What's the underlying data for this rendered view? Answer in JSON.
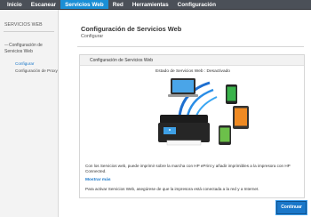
{
  "nav": {
    "tabs": [
      {
        "label": "Inicio"
      },
      {
        "label": "Escanear"
      },
      {
        "label": "Servicios Web",
        "active": true
      },
      {
        "label": "Red"
      },
      {
        "label": "Herramientas"
      },
      {
        "label": "Configuración"
      }
    ]
  },
  "sidebar": {
    "title": "SERVICIOS WEB",
    "group_label": "Configuración de Servicios Web",
    "items": [
      {
        "label": "Configurar",
        "active": true
      },
      {
        "label": "Configuración de Proxy"
      }
    ]
  },
  "main": {
    "title": "Configuración de Servicios Web",
    "subtitle": "Configurar",
    "panel_title": "Configuración de Servicios Web",
    "status": "Estado de Servicios Web : Desactivado",
    "description": "Con los Servicios web, puede imprimir sobre la marcha con HP ePrint y añadir imprimibles a la impresora con HP Connected.",
    "more_link": "Mostrar más",
    "instruction": "Para activar Servicios Web, asegúrese de que la impresora está conectada a la red y a Internet."
  },
  "buttons": {
    "continue": "Continuar"
  },
  "colors": {
    "nav_bg": "#4b5058",
    "accent": "#1a8fd6",
    "link": "#1a77c9"
  }
}
